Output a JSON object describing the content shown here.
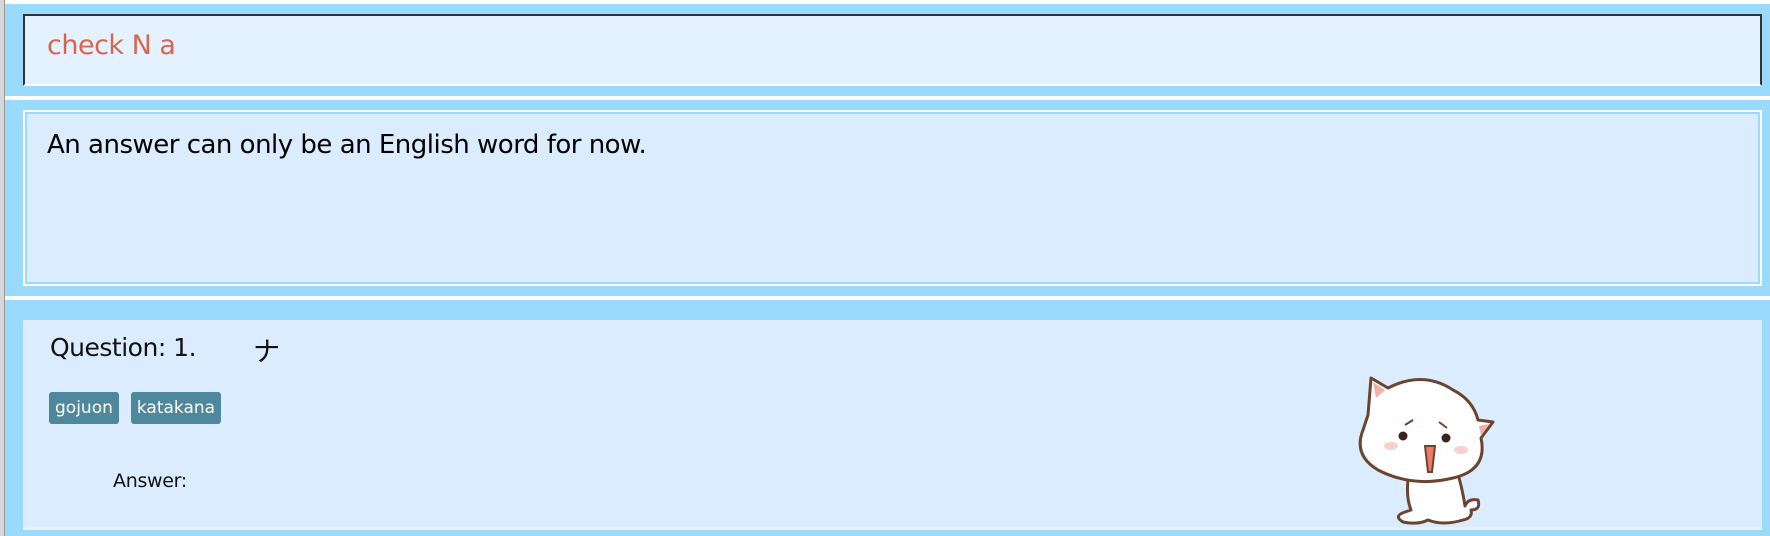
{
  "input": {
    "value": "check N a"
  },
  "message": {
    "text": "An answer can only be an English word for now."
  },
  "question": {
    "label": "Question: 1.",
    "character": "ナ",
    "tags": [
      "gojuon",
      "katakana"
    ],
    "answer_label": "Answer:"
  },
  "colors": {
    "panel": "#99dafd",
    "input_text": "#d8654e",
    "tag": "#4e889d"
  }
}
